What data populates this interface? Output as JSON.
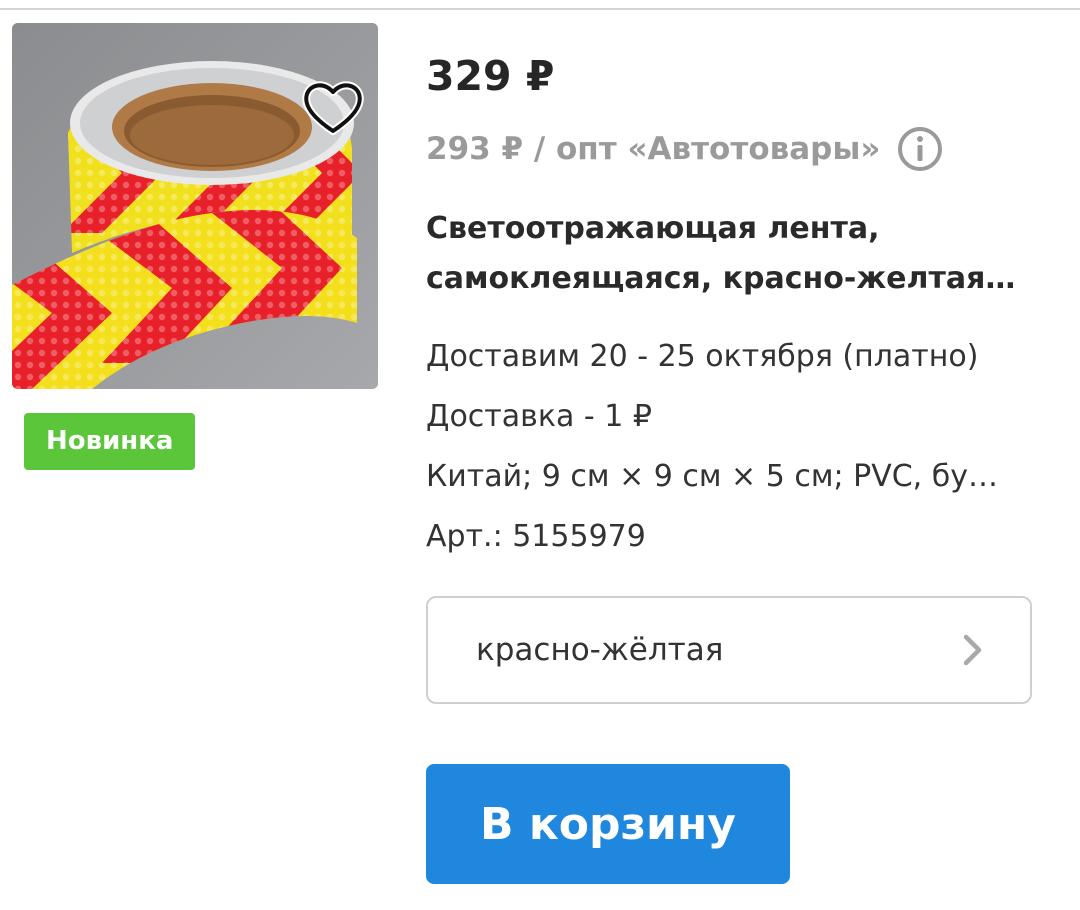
{
  "product": {
    "image_alt": "product-image",
    "badge": "Новинка",
    "price": "329 ₽",
    "wholesale_price": "293 ₽ / опт «Автотовары»",
    "title_line1": "Светоотражающая лента,",
    "title_line2": "самоклеящаяся, красно-желтая…",
    "delivery_date": "Доставим 20 - 25 октября (платно)",
    "delivery_cost": "Доставка - 1 ₽",
    "specs": "Китай; 9 см × 9 см × 5 см; PVC, бу…",
    "article": "Арт.: 5155979",
    "variant": "красно-жёлтая",
    "cart_label": "В корзину"
  },
  "colors": {
    "badge_green": "#5bc63a",
    "cart_blue": "#1f87dd",
    "muted_gray": "#9a9a9a",
    "tape_red": "#e8202a",
    "tape_yellow": "#f4df1c"
  },
  "icons": {
    "favorite": "heart-icon",
    "info": "info-icon",
    "select_arrow": "chevron-right-icon"
  }
}
